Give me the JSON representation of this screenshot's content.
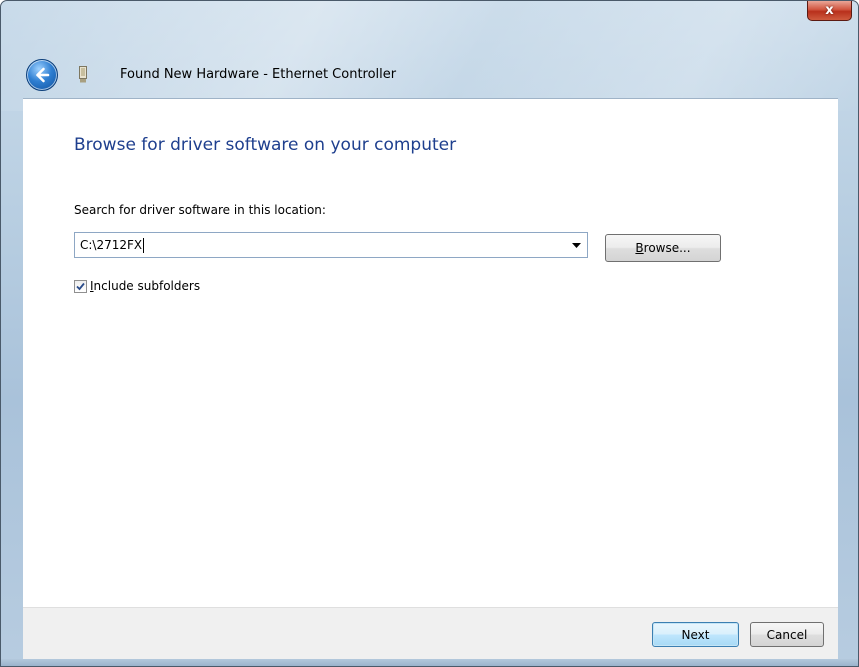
{
  "window": {
    "title": "Found New Hardware - Ethernet Controller",
    "close_glyph": "x"
  },
  "header": {
    "back_icon": "back-arrow-icon",
    "device_icon": "hardware-device-icon"
  },
  "main": {
    "heading": "Browse for driver software on your computer",
    "location_label": "Search for driver software in this location:",
    "location_value": "C:\\2712FX",
    "browse_label_accel": "B",
    "browse_label_rest": "rowse...",
    "include_subfolders_checked": true,
    "include_subfolders_accel": "I",
    "include_subfolders_rest": "nclude subfolders"
  },
  "footer": {
    "next_label": "Next",
    "cancel_label": "Cancel"
  },
  "colors": {
    "heading": "#1e3f8e",
    "glass_frame": "#b9cfe2",
    "close_button": "#c8452f"
  }
}
